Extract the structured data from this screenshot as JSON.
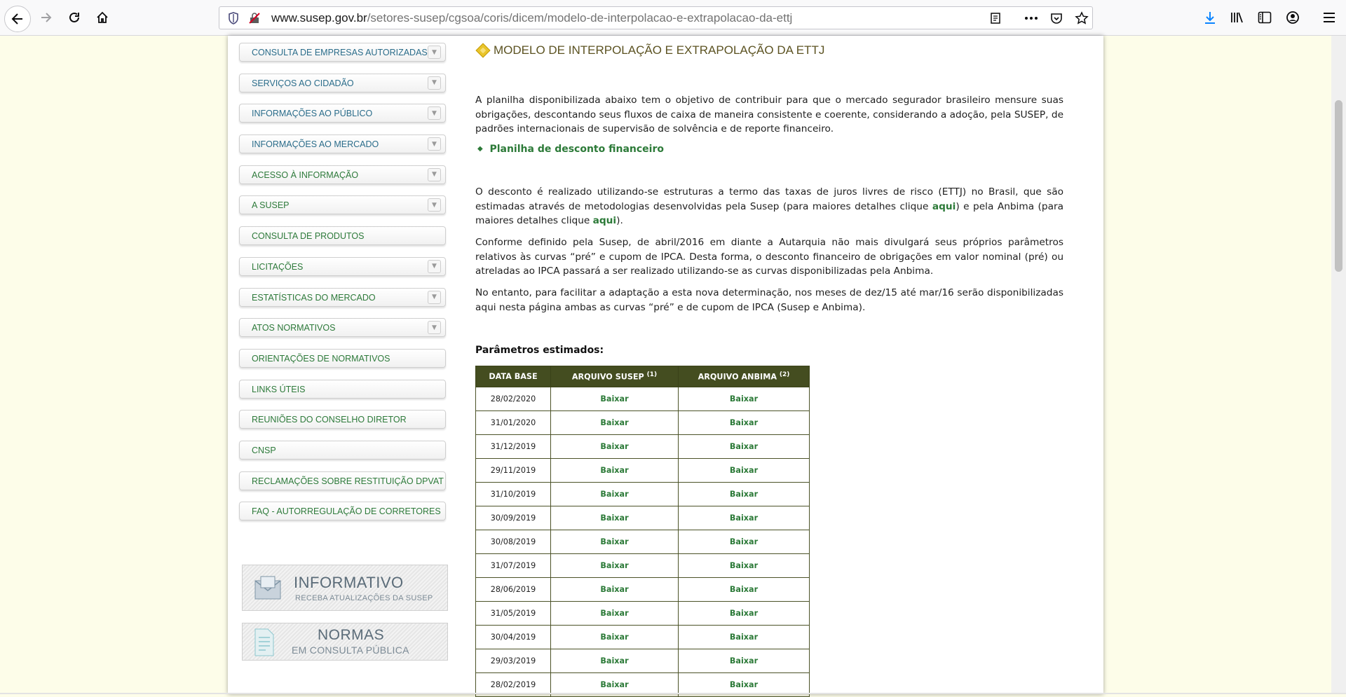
{
  "browser": {
    "url_host": "www.susep.gov.br",
    "url_path": "/setores-susep/cgsoa/coris/dicem/modelo-de-interpolacao-e-extrapolacao-da-ettj"
  },
  "sidebar": {
    "items": [
      {
        "label": "CONSULTA DE EMPRESAS AUTORIZADAS",
        "has_arrow": true
      },
      {
        "label": "SERVIÇOS AO CIDADÃO",
        "has_arrow": true
      },
      {
        "label": "INFORMAÇÕES AO PÚBLICO",
        "has_arrow": true
      },
      {
        "label": "INFORMAÇÕES AO MERCADO",
        "has_arrow": true
      },
      {
        "label": "ACESSO À INFORMAÇÃO",
        "has_arrow": true
      },
      {
        "label": "A SUSEP",
        "has_arrow": true
      },
      {
        "label": "CONSULTA DE PRODUTOS",
        "has_arrow": false
      },
      {
        "label": "LICITAÇÕES",
        "has_arrow": true
      },
      {
        "label": "ESTATÍSTICAS DO MERCADO",
        "has_arrow": true
      },
      {
        "label": "ATOS NORMATIVOS",
        "has_arrow": true
      },
      {
        "label": "ORIENTAÇÕES DE NORMATIVOS",
        "has_arrow": false
      },
      {
        "label": "LINKS ÚTEIS",
        "has_arrow": false
      },
      {
        "label": "REUNIÕES DO CONSELHO DIRETOR",
        "has_arrow": false
      },
      {
        "label": "CNSP",
        "has_arrow": false
      },
      {
        "label": "RECLAMAÇÕES SOBRE RESTITUIÇÃO DPVAT",
        "has_arrow": false
      },
      {
        "label": "FAQ - AUTORREGULAÇÃO DE CORRETORES",
        "has_arrow": false
      }
    ],
    "banner_informativo": {
      "title": "INFORMATIVO",
      "subtitle": "RECEBA ATUALIZAÇÕES DA SUSEP"
    },
    "banner_normas": {
      "title": "NORMAS",
      "subtitle": "EM CONSULTA PÚBLICA"
    }
  },
  "main": {
    "title": "MODELO DE INTERPOLAÇÃO E EXTRAPOLAÇÃO DA ETTJ",
    "intro": "A planilha disponibilizada abaixo tem o objetivo de contribuir para que o mercado segurador brasileiro mensure suas obrigações, descontando seus fluxos de caixa de maneira consistente e coerente, considerando a adoção, pela SUSEP, de padrões internacionais de supervisão de solvência e de reporte financeiro.",
    "spreadsheet_link": "Planilha de desconto financeiro",
    "p2_a": "O desconto é realizado utilizando-se estruturas a termo das taxas de juros livres de risco (ETTJ) no Brasil, que são estimadas através de metodologias desenvolvidas pela Susep (para maiores detalhes clique ",
    "p2_link1": "aqui",
    "p2_b": ") e pela Anbima (para maiores detalhes clique ",
    "p2_link2": "aqui",
    "p2_c": ").",
    "p3": "Conforme definido pela Susep, de abril/2016 em diante a Autarquia não mais divulgará seus próprios parâmetros relativos às curvas “pré” e cupom de IPCA. Desta forma, o desconto financeiro de obrigações em valor nominal (pré) ou atreladas ao IPCA passará a ser realizado utilizando-se as curvas disponibilizadas pela Anbima.",
    "p4": "No entanto, para facilitar a adaptação a esta nova determinação, nos meses de dez/15 até mar/16 serão disponibilizadas aqui nesta página ambas as curvas “pré” e de cupom de IPCA (Susep e Anbima).",
    "params_title": "Parâmetros estimados:",
    "table": {
      "headers": [
        "DATA BASE",
        "ARQUIVO SUSEP",
        "ARQUIVO ANBIMA"
      ],
      "sup1": "(1)",
      "sup2": "(2)",
      "rows": [
        {
          "date": "28/02/2020",
          "susep": "Baixar",
          "anbima": "Baixar"
        },
        {
          "date": "31/01/2020",
          "susep": "Baixar",
          "anbima": "Baixar"
        },
        {
          "date": "31/12/2019",
          "susep": "Baixar",
          "anbima": "Baixar"
        },
        {
          "date": "29/11/2019",
          "susep": "Baixar",
          "anbima": "Baixar"
        },
        {
          "date": "31/10/2019",
          "susep": "Baixar",
          "anbima": "Baixar"
        },
        {
          "date": "30/09/2019",
          "susep": "Baixar",
          "anbima": "Baixar"
        },
        {
          "date": "30/08/2019",
          "susep": "Baixar",
          "anbima": "Baixar"
        },
        {
          "date": "31/07/2019",
          "susep": "Baixar",
          "anbima": "Baixar"
        },
        {
          "date": "28/06/2019",
          "susep": "Baixar",
          "anbima": "Baixar"
        },
        {
          "date": "31/05/2019",
          "susep": "Baixar",
          "anbima": "Baixar"
        },
        {
          "date": "30/04/2019",
          "susep": "Baixar",
          "anbima": "Baixar"
        },
        {
          "date": "29/03/2019",
          "susep": "Baixar",
          "anbima": "Baixar"
        },
        {
          "date": "28/02/2019",
          "susep": "Baixar",
          "anbima": "Baixar"
        }
      ]
    }
  },
  "colors": {
    "menu_blue": "#2a6c8a",
    "menu_green": "#2d7a3a",
    "link_green": "#2c7a38",
    "table_header": "#444d20",
    "title_color": "#5c5322"
  }
}
